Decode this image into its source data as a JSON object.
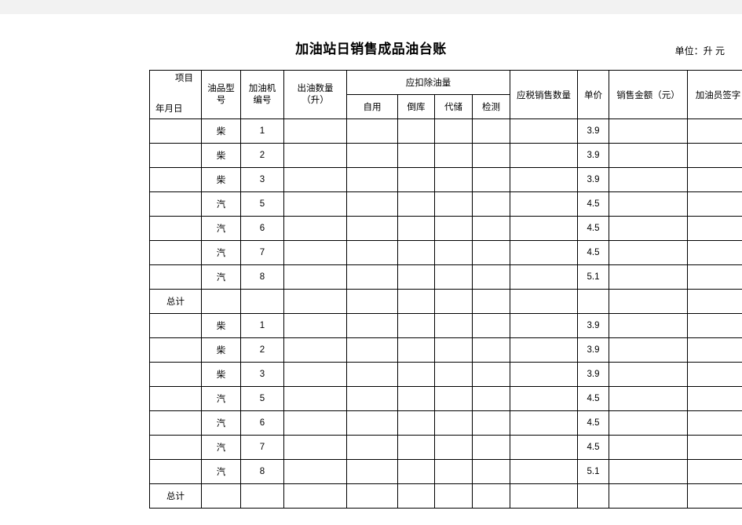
{
  "document": {
    "title": "加油站日销售成品油台账",
    "unit_note": "单位：升 元"
  },
  "table": {
    "header": {
      "corner_top": "项目",
      "corner_bottom": "年月日",
      "oil_type": "油品型号",
      "oil_type_line1": "油品型",
      "oil_type_line2": "号",
      "machine_no": "加油机编号",
      "machine_no_line1": "加油机",
      "machine_no_line2": "编号",
      "output_qty": "出油数量（升）",
      "output_qty_line1": "出油数量",
      "output_qty_line2": "（升）",
      "deduction_group": "应扣除油量",
      "deduction_self": "自用",
      "deduction_move": "倒库",
      "deduction_store": "代储",
      "deduction_test": "检测",
      "taxable_qty": "应税销售数量",
      "unit_price": "单价",
      "sales_amount": "销售金额（元）",
      "attendant_sign": "加油员签字"
    },
    "total_label": "总计",
    "blocks": [
      {
        "rows": [
          {
            "date": "",
            "type": "柴",
            "machine": "1",
            "output": "",
            "self": "",
            "move": "",
            "store": "",
            "test": "",
            "taxable": "",
            "price": "3.9",
            "amount": "",
            "sign": ""
          },
          {
            "date": "",
            "type": "柴",
            "machine": "2",
            "output": "",
            "self": "",
            "move": "",
            "store": "",
            "test": "",
            "taxable": "",
            "price": "3.9",
            "amount": "",
            "sign": ""
          },
          {
            "date": "",
            "type": "柴",
            "machine": "3",
            "output": "",
            "self": "",
            "move": "",
            "store": "",
            "test": "",
            "taxable": "",
            "price": "3.9",
            "amount": "",
            "sign": ""
          },
          {
            "date": "",
            "type": "汽",
            "machine": "5",
            "output": "",
            "self": "",
            "move": "",
            "store": "",
            "test": "",
            "taxable": "",
            "price": "4.5",
            "amount": "",
            "sign": ""
          },
          {
            "date": "",
            "type": "汽",
            "machine": "6",
            "output": "",
            "self": "",
            "move": "",
            "store": "",
            "test": "",
            "taxable": "",
            "price": "4.5",
            "amount": "",
            "sign": ""
          },
          {
            "date": "",
            "type": "汽",
            "machine": "7",
            "output": "",
            "self": "",
            "move": "",
            "store": "",
            "test": "",
            "taxable": "",
            "price": "4.5",
            "amount": "",
            "sign": ""
          },
          {
            "date": "",
            "type": "汽",
            "machine": "8",
            "output": "",
            "self": "",
            "move": "",
            "store": "",
            "test": "",
            "taxable": "",
            "price": "5.1",
            "amount": "",
            "sign": ""
          }
        ],
        "total": {
          "date": "总计",
          "type": "",
          "machine": "",
          "output": "",
          "self": "",
          "move": "",
          "store": "",
          "test": "",
          "taxable": "",
          "price": "",
          "amount": "",
          "sign": ""
        }
      },
      {
        "rows": [
          {
            "date": "",
            "type": "柴",
            "machine": "1",
            "output": "",
            "self": "",
            "move": "",
            "store": "",
            "test": "",
            "taxable": "",
            "price": "3.9",
            "amount": "",
            "sign": ""
          },
          {
            "date": "",
            "type": "柴",
            "machine": "2",
            "output": "",
            "self": "",
            "move": "",
            "store": "",
            "test": "",
            "taxable": "",
            "price": "3.9",
            "amount": "",
            "sign": ""
          },
          {
            "date": "",
            "type": "柴",
            "machine": "3",
            "output": "",
            "self": "",
            "move": "",
            "store": "",
            "test": "",
            "taxable": "",
            "price": "3.9",
            "amount": "",
            "sign": ""
          },
          {
            "date": "",
            "type": "汽",
            "machine": "5",
            "output": "",
            "self": "",
            "move": "",
            "store": "",
            "test": "",
            "taxable": "",
            "price": "4.5",
            "amount": "",
            "sign": ""
          },
          {
            "date": "",
            "type": "汽",
            "machine": "6",
            "output": "",
            "self": "",
            "move": "",
            "store": "",
            "test": "",
            "taxable": "",
            "price": "4.5",
            "amount": "",
            "sign": ""
          },
          {
            "date": "",
            "type": "汽",
            "machine": "7",
            "output": "",
            "self": "",
            "move": "",
            "store": "",
            "test": "",
            "taxable": "",
            "price": "4.5",
            "amount": "",
            "sign": ""
          },
          {
            "date": "",
            "type": "汽",
            "machine": "8",
            "output": "",
            "self": "",
            "move": "",
            "store": "",
            "test": "",
            "taxable": "",
            "price": "5.1",
            "amount": "",
            "sign": ""
          }
        ],
        "total": {
          "date": "总计",
          "type": "",
          "machine": "",
          "output": "",
          "self": "",
          "move": "",
          "store": "",
          "test": "",
          "taxable": "",
          "price": "",
          "amount": "",
          "sign": ""
        }
      }
    ]
  }
}
